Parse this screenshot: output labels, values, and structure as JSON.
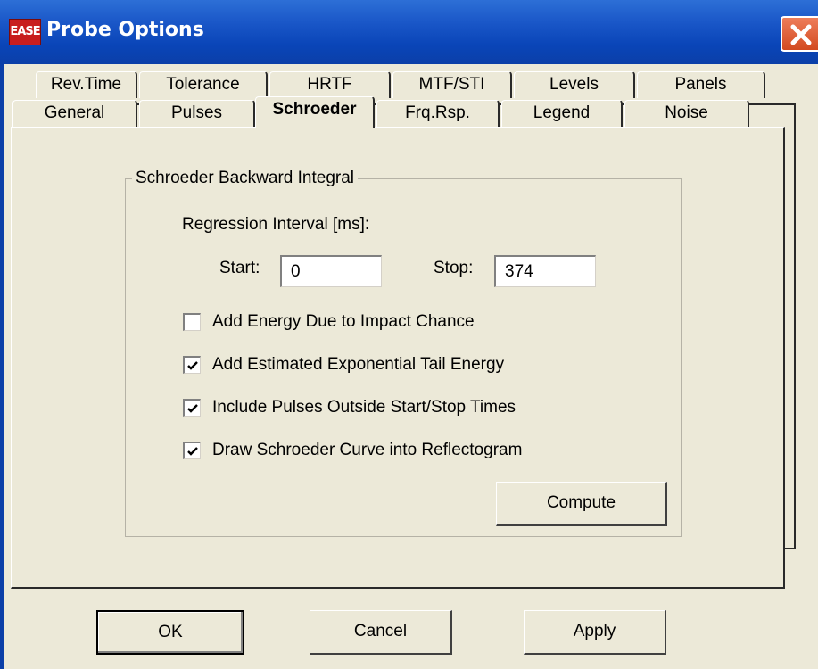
{
  "window": {
    "icon_text": "EASE",
    "title": "Probe Options"
  },
  "tabs_back_row": [
    {
      "label": "Rev.Time"
    },
    {
      "label": "Tolerance"
    },
    {
      "label": "HRTF"
    },
    {
      "label": "MTF/STI"
    },
    {
      "label": "Levels"
    },
    {
      "label": "Panels"
    }
  ],
  "tabs_front_row": [
    {
      "label": "General"
    },
    {
      "label": "Pulses"
    },
    {
      "label": "Schroeder",
      "selected": true
    },
    {
      "label": "Frq.Rsp."
    },
    {
      "label": "Legend"
    },
    {
      "label": "Noise"
    }
  ],
  "schroeder": {
    "group_title": "Schroeder Backward Integral",
    "regression_label": "Regression Interval [ms]:",
    "start_label": "Start:",
    "start_value": "0",
    "stop_label": "Stop:",
    "stop_value": "374",
    "options": [
      {
        "label": "Add Energy Due to Impact Chance",
        "checked": false
      },
      {
        "label": "Add Estimated Exponential Tail Energy",
        "checked": true
      },
      {
        "label": "Include Pulses Outside Start/Stop Times",
        "checked": true
      },
      {
        "label": "Draw Schroeder Curve into Reflectogram",
        "checked": true
      }
    ],
    "compute_label": "Compute"
  },
  "footer": {
    "ok_label": "OK",
    "cancel_label": "Cancel",
    "apply_label": "Apply"
  },
  "colors": {
    "titlebar": "#0b3fa8",
    "face": "#ece9d8",
    "close": "#d24a20"
  }
}
